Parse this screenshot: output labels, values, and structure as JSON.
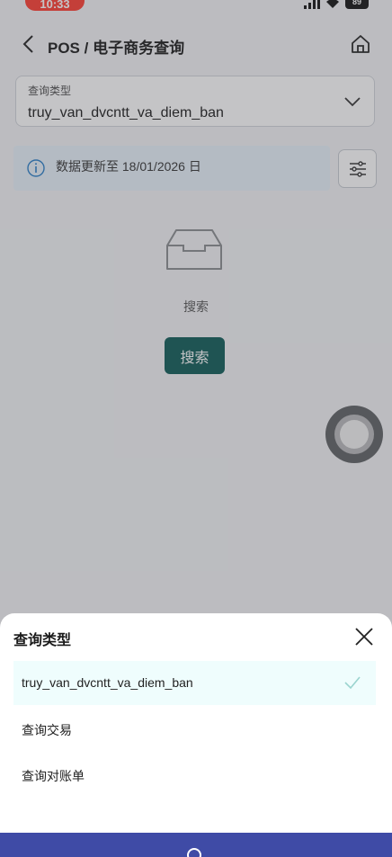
{
  "status_bar": {
    "time": "10:33",
    "battery": "89"
  },
  "header": {
    "title": "POS / 电子商务查询"
  },
  "query_type": {
    "label": "查询类型",
    "value": "truy_van_dvcntt_va_diem_ban"
  },
  "info_banner": {
    "text": "数据更新至 18/01/2026 日"
  },
  "empty_state": {
    "text": "搜索",
    "button_label": "搜索"
  },
  "sheet": {
    "title": "查询类型",
    "options": [
      {
        "label": "truy_van_dvcntt_va_diem_ban",
        "selected": true
      },
      {
        "label": "查询交易",
        "selected": false
      },
      {
        "label": "查询对账单",
        "selected": false
      }
    ]
  },
  "colors": {
    "accent": "#0d5a56",
    "bottom_bar": "#3f4ba6",
    "selected_bg": "#effdfd"
  }
}
